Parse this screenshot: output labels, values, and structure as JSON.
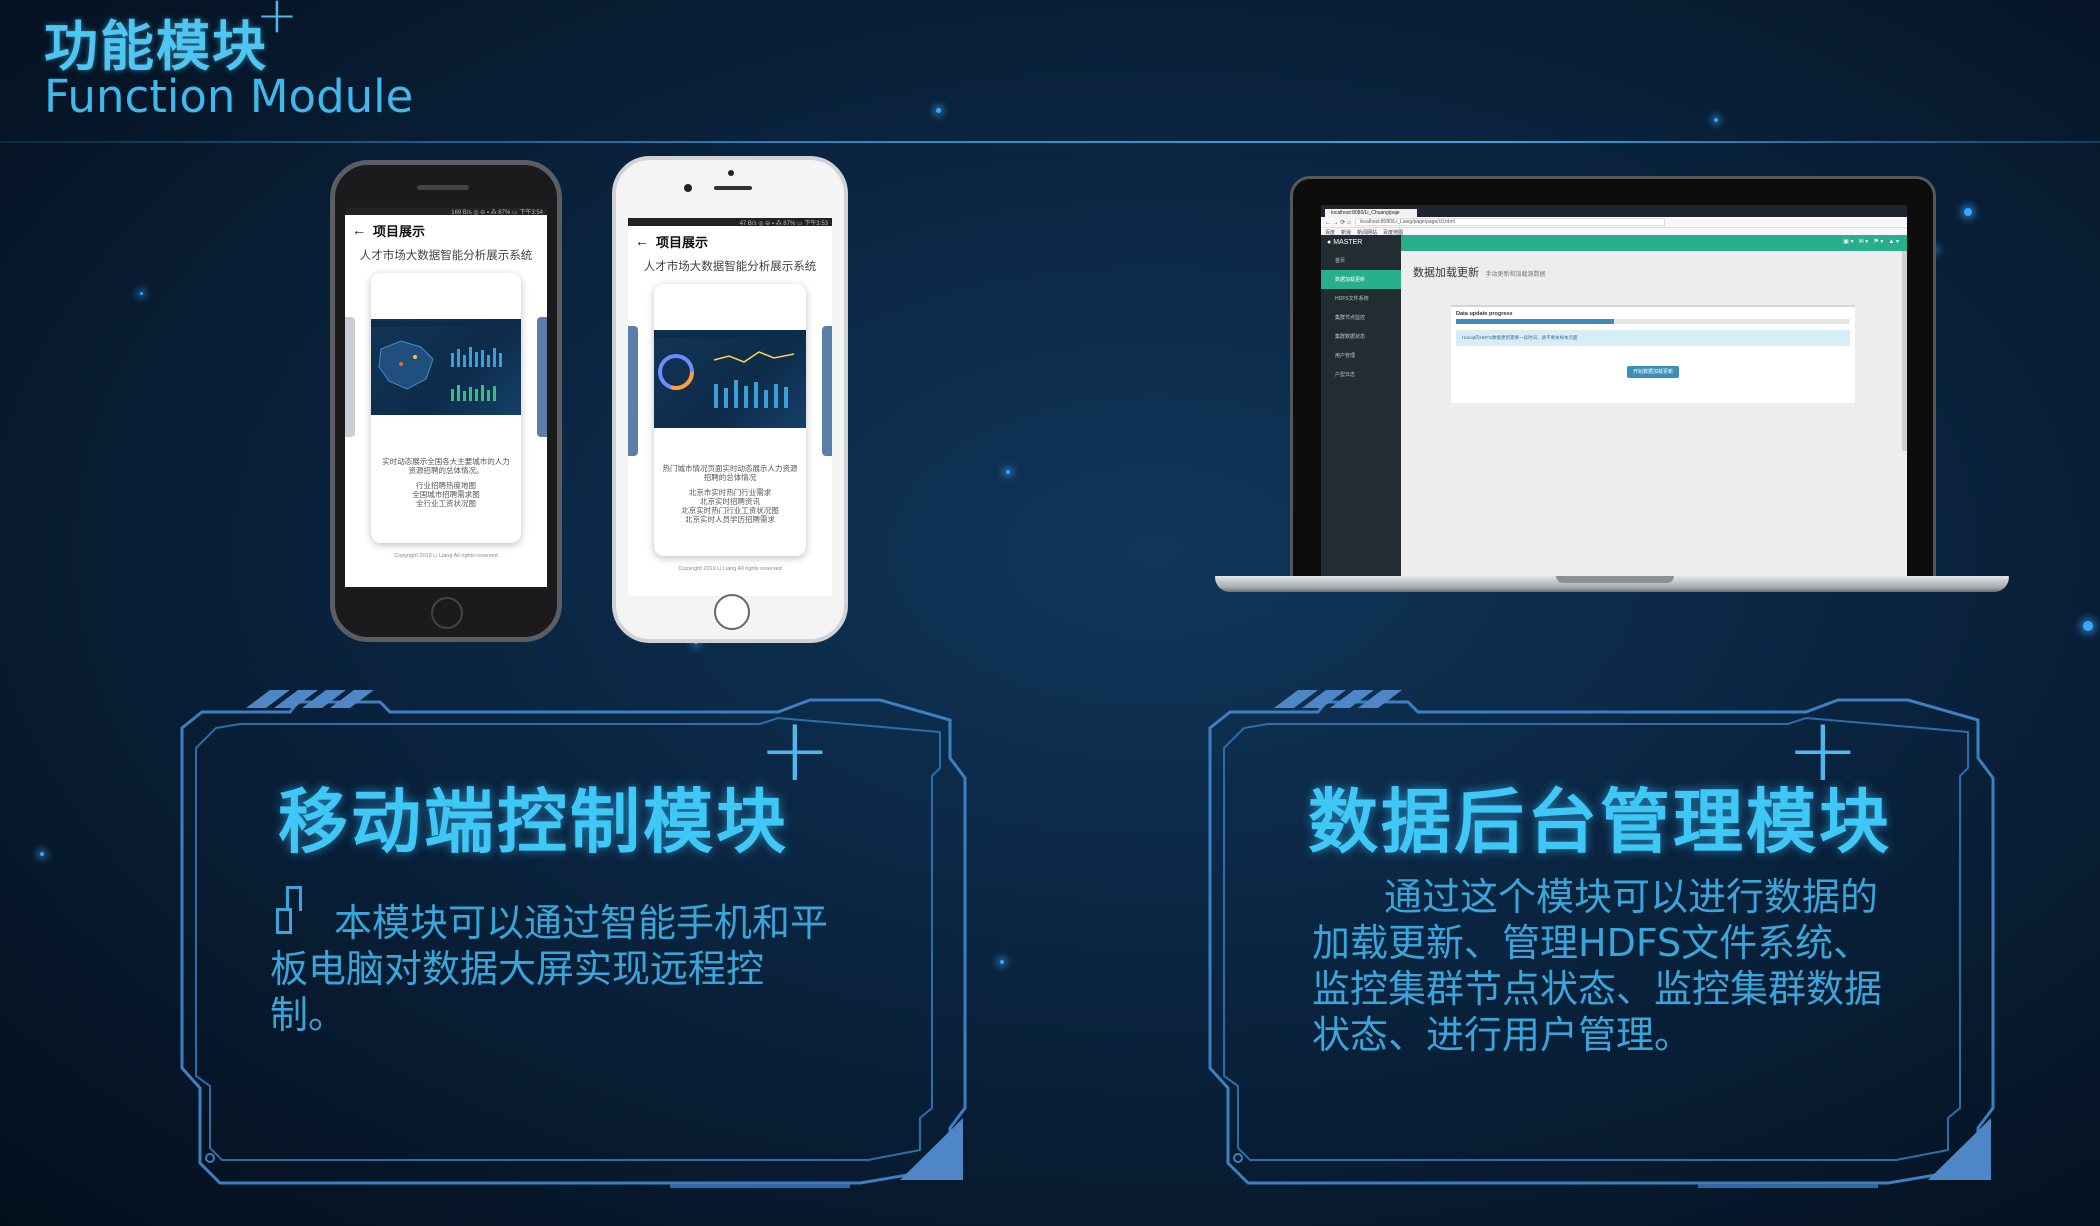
{
  "header": {
    "title_cn": "功能模块",
    "title_en": "Function Module"
  },
  "phone_black": {
    "status": "169 B/s ◎ ⊖ ▪ ⁂ 87% ▭ 下午3:54",
    "appbar_title": "项目展示",
    "subtitle": "人才市场大数据智能分析展示系统",
    "card_text": [
      "实时动态展示全国各大主要城市的人力资源招聘的总体情况。",
      "行业招聘热度地图",
      "全国城市招聘需求图",
      "全行业工资状况图"
    ],
    "copyright": "Copyright 2019 Li Liang All rights reserved"
  },
  "phone_white": {
    "status": "47 B/s ◎ ⊖ ▪ ⁂ 87% ▭ 下午3:53",
    "appbar_title": "项目展示",
    "subtitle": "人才市场大数据智能分析展示系统",
    "card_text": [
      "热门城市情况页面实时动态展示人力资源招聘的总体情况",
      "北京市实时热门行业需求",
      "北京实时招聘资讯",
      "北京实时热门行业工资状况图",
      "北京实时人员学历招聘需求"
    ],
    "copyright": "Copyright 2019 Li Liang All rights reserved"
  },
  "laptop": {
    "tab_label": "localhost:8080/Li_Chuang/paje",
    "url": "localhost:8080/Li_Liang/page/page/c0.html",
    "bookmarks": [
      "百度",
      "新浪",
      "新闻网站",
      "百度地图"
    ],
    "brand": "MASTER",
    "sidebar_items": [
      "首页",
      "数据加载更新",
      "HDFS文件系统",
      "集群节点监控",
      "集群数据状态",
      "用户管理",
      "户型日志"
    ],
    "page_title": "数据加载更新",
    "page_subtitle": "手动更新和加载源数据",
    "box_title": "Data update progress",
    "progress_fraction": 0.4,
    "info_text": "Hdoop的HDFS数据更新需要一段时间，请不要关掉本页面",
    "button_label": "开始数据加载更新"
  },
  "panels": {
    "left": {
      "title": "移动端控制模块",
      "body": "本模块可以通过智能手机和平板电脑对数据大屏实现远程控制。"
    },
    "right": {
      "title": "数据后台管理模块",
      "body": "通过这个模块可以进行数据的加载更新、管理HDFS文件系统、监控集群节点状态、监控集群数据状态、进行用户管理。"
    }
  },
  "colors": {
    "accent": "#3fc7f5",
    "frame": "#3c80c0",
    "body_text": "#3aa5d8",
    "bg": "#0a2440"
  }
}
